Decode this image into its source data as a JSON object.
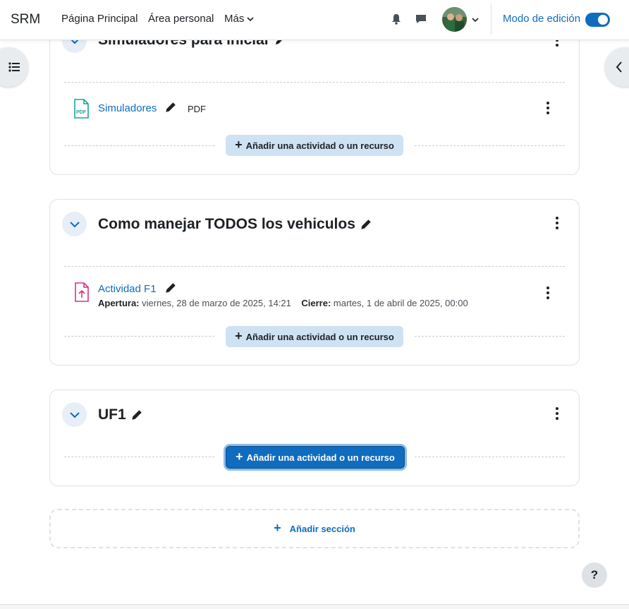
{
  "navbar": {
    "brand": "SRM",
    "links": [
      "Página Principal",
      "Área personal"
    ],
    "more_label": "Más",
    "edit_mode_label": "Modo de edición",
    "edit_mode_on": true,
    "icons": [
      "bell-icon",
      "chat-icon",
      "chevron-down-icon"
    ]
  },
  "sections": [
    {
      "title": "Simuladores para iniciar",
      "activities": [
        {
          "name": "Simuladores",
          "type_label": "PDF",
          "icon": "pdf-icon"
        }
      ],
      "add_label": "Añadir una actividad o un recurso"
    },
    {
      "title": "Como manejar TODOS los vehiculos",
      "activities": [
        {
          "name": "Actividad F1",
          "icon": "assignment-upload-icon",
          "open_label": "Apertura:",
          "open_value": "viernes, 28 de marzo de 2025, 14:21",
          "close_label": "Cierre:",
          "close_value": "martes, 1 de abril de 2025, 00:00"
        }
      ],
      "add_label": "Añadir una actividad o un recurso"
    },
    {
      "title": "UF1",
      "activities": [],
      "add_label": "Añadir una actividad o un recurso"
    }
  ],
  "add_section_label": "Añadir sección",
  "help_label": "?",
  "colors": {
    "primary": "#0f6cbf",
    "add_button_bg": "#cfe2f3",
    "pdf_icon": "#1aa39a",
    "assignment_icon": "#d63384"
  }
}
